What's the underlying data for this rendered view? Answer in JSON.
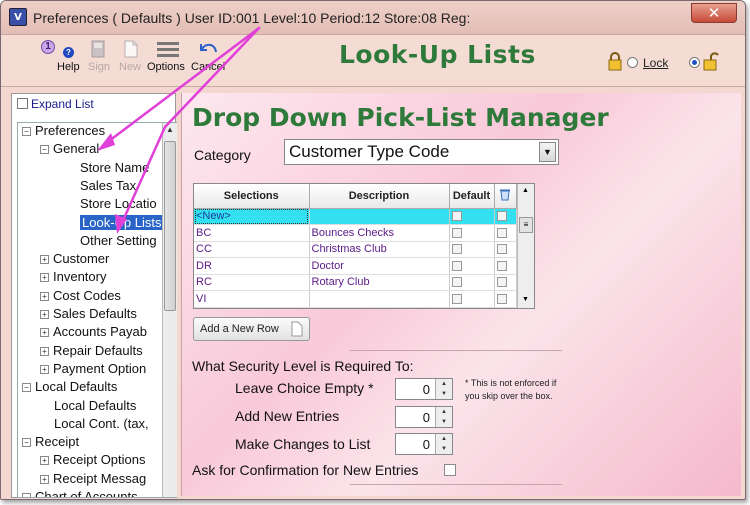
{
  "window": {
    "title": "Preferences ( Defaults )   User ID:001 Level:10 Period:12 Store:08 Reg:",
    "close_glyph": "✕",
    "app_icon_text": "V"
  },
  "toolbar": {
    "badge": "1",
    "help_label": "Help",
    "sign_label": "Sign",
    "new_label": "New",
    "options_label": "Options",
    "cancel_label": "Cancel",
    "page_title": "Look-Up Lists",
    "lock_label": "Lock"
  },
  "sidebar": {
    "expand_label": "Expand List",
    "tree": [
      {
        "label": "Preferences",
        "level": 0,
        "toggle": "-"
      },
      {
        "label": "General",
        "level": 1,
        "toggle": "-"
      },
      {
        "label": "Store Name",
        "level": 2,
        "toggle": ""
      },
      {
        "label": "Sales Tax",
        "level": 2,
        "toggle": ""
      },
      {
        "label": "Store Locatio",
        "level": 2,
        "toggle": ""
      },
      {
        "label": "Look-Up Lists",
        "level": 2,
        "toggle": "",
        "selected": true
      },
      {
        "label": "Other Setting",
        "level": 2,
        "toggle": ""
      },
      {
        "label": "Customer",
        "level": 1,
        "toggle": "+"
      },
      {
        "label": "Inventory",
        "level": 1,
        "toggle": "+"
      },
      {
        "label": "Cost Codes",
        "level": 1,
        "toggle": "+"
      },
      {
        "label": "Sales Defaults",
        "level": 1,
        "toggle": "+"
      },
      {
        "label": "Accounts Payab",
        "level": 1,
        "toggle": "+"
      },
      {
        "label": "Repair Defaults",
        "level": 1,
        "toggle": "+"
      },
      {
        "label": "Payment Option",
        "level": 1,
        "toggle": "+"
      },
      {
        "label": "Local Defaults",
        "level": 0,
        "toggle": "-"
      },
      {
        "label": "Local Defaults",
        "level": 1,
        "toggle": ""
      },
      {
        "label": "Local Cont. (tax,",
        "level": 1,
        "toggle": ""
      },
      {
        "label": "Receipt",
        "level": 0,
        "toggle": "-"
      },
      {
        "label": "Receipt Options",
        "level": 1,
        "toggle": "+"
      },
      {
        "label": "Receipt Messag",
        "level": 1,
        "toggle": "+"
      },
      {
        "label": "Chart of Accounts",
        "level": 0,
        "toggle": "-"
      }
    ]
  },
  "main": {
    "heading": "Drop Down Pick-List Manager",
    "category_label": "Category",
    "category_value": "Customer Type Code",
    "grid": {
      "columns": [
        "Selections",
        "Description",
        "Default",
        "."
      ],
      "rows": [
        {
          "selection": "<New>",
          "description": "",
          "is_new": true
        },
        {
          "selection": "BC",
          "description": "Bounces Checks"
        },
        {
          "selection": "CC",
          "description": "Christmas Club"
        },
        {
          "selection": "DR",
          "description": "Doctor"
        },
        {
          "selection": "RC",
          "description": "Rotary Club"
        },
        {
          "selection": "VI",
          "description": ""
        }
      ]
    },
    "add_row_label": "Add a New Row",
    "security": {
      "title": "What Security Level is Required To:",
      "leave_empty_label": "Leave Choice Empty *",
      "leave_empty_value": "0",
      "add_new_label": "Add New Entries",
      "add_new_value": "0",
      "make_changes_label": "Make Changes to List",
      "make_changes_value": "0",
      "note_line1": "* This is not  enforced if",
      "note_line2": "you skip over the box."
    },
    "ask_confirm_label": "Ask for Confirmation for New Entries"
  },
  "colors": {
    "heading_green": "#2e7a3a",
    "selection_blue": "#2a64c8",
    "new_row_cyan": "#33e0f0",
    "annotation_magenta": "#e040d8"
  }
}
